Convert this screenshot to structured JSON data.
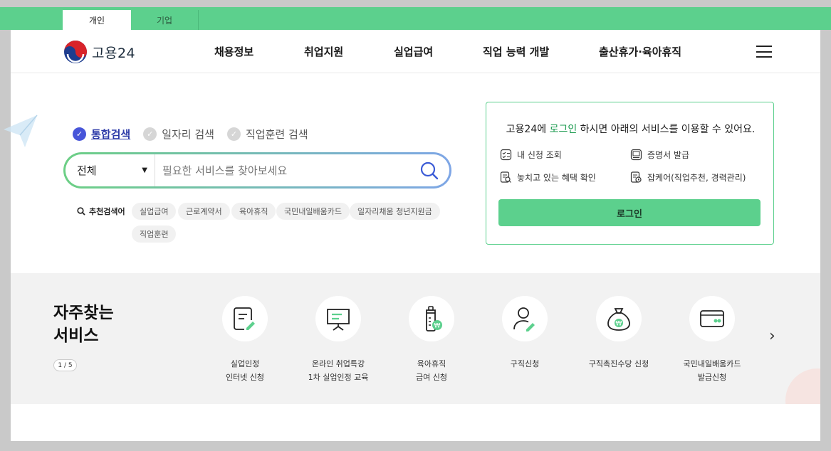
{
  "topbar": {
    "tabs": [
      "개인",
      "기업"
    ]
  },
  "header": {
    "logo_text": "고용24",
    "nav": [
      "채용정보",
      "취업지원",
      "실업급여",
      "직업 능력 개발",
      "출산휴가·육아휴직"
    ],
    "menu_icon": "hamburger-icon"
  },
  "search": {
    "tabs": [
      {
        "label": "통합검색",
        "active": true
      },
      {
        "label": "일자리 검색",
        "active": false
      },
      {
        "label": "직업훈련 검색",
        "active": false
      }
    ],
    "select_value": "전체",
    "placeholder": "필요한 서비스를 찾아보세요",
    "recommend_label": "추천검색어",
    "keywords": [
      "실업급여",
      "근로계약서",
      "육아휴직",
      "국민내일배움카드",
      "일자리채움 청년지원금",
      "직업훈련"
    ]
  },
  "login_box": {
    "msg_prefix": "고용24에 ",
    "msg_highlight": "로그인",
    "msg_suffix": " 하시면 아래의 서비스를 이용할 수 있어요.",
    "services": [
      "내 신청 조회",
      "증명서 발급",
      "놓치고 있는 혜택 확인",
      "잡케어(직업추천, 경력관리)"
    ],
    "button": "로그인"
  },
  "frequent": {
    "title_line1": "자주찾는",
    "title_line2": "서비스",
    "pager": "1 / 5",
    "items": [
      {
        "line1": "실업인정",
        "line2": "인터넷 신청",
        "icon": "document-pen-icon"
      },
      {
        "line1": "온라인 취업특강",
        "line2": "1차 실업인정 교육",
        "icon": "presentation-board-icon"
      },
      {
        "line1": "육아휴직",
        "line2": "급여 신청",
        "icon": "baby-bottle-won-icon"
      },
      {
        "line1": "구직신청",
        "line2": "",
        "icon": "person-pen-icon"
      },
      {
        "line1": "구직촉진수당 신청",
        "line2": "",
        "icon": "money-bag-icon"
      },
      {
        "line1": "국민내일배움카드",
        "line2": "발급신청",
        "icon": "card-icon"
      }
    ]
  },
  "colors": {
    "green": "#5cd08d",
    "blue": "#4755d9",
    "highlight": "#1a9a4e"
  }
}
